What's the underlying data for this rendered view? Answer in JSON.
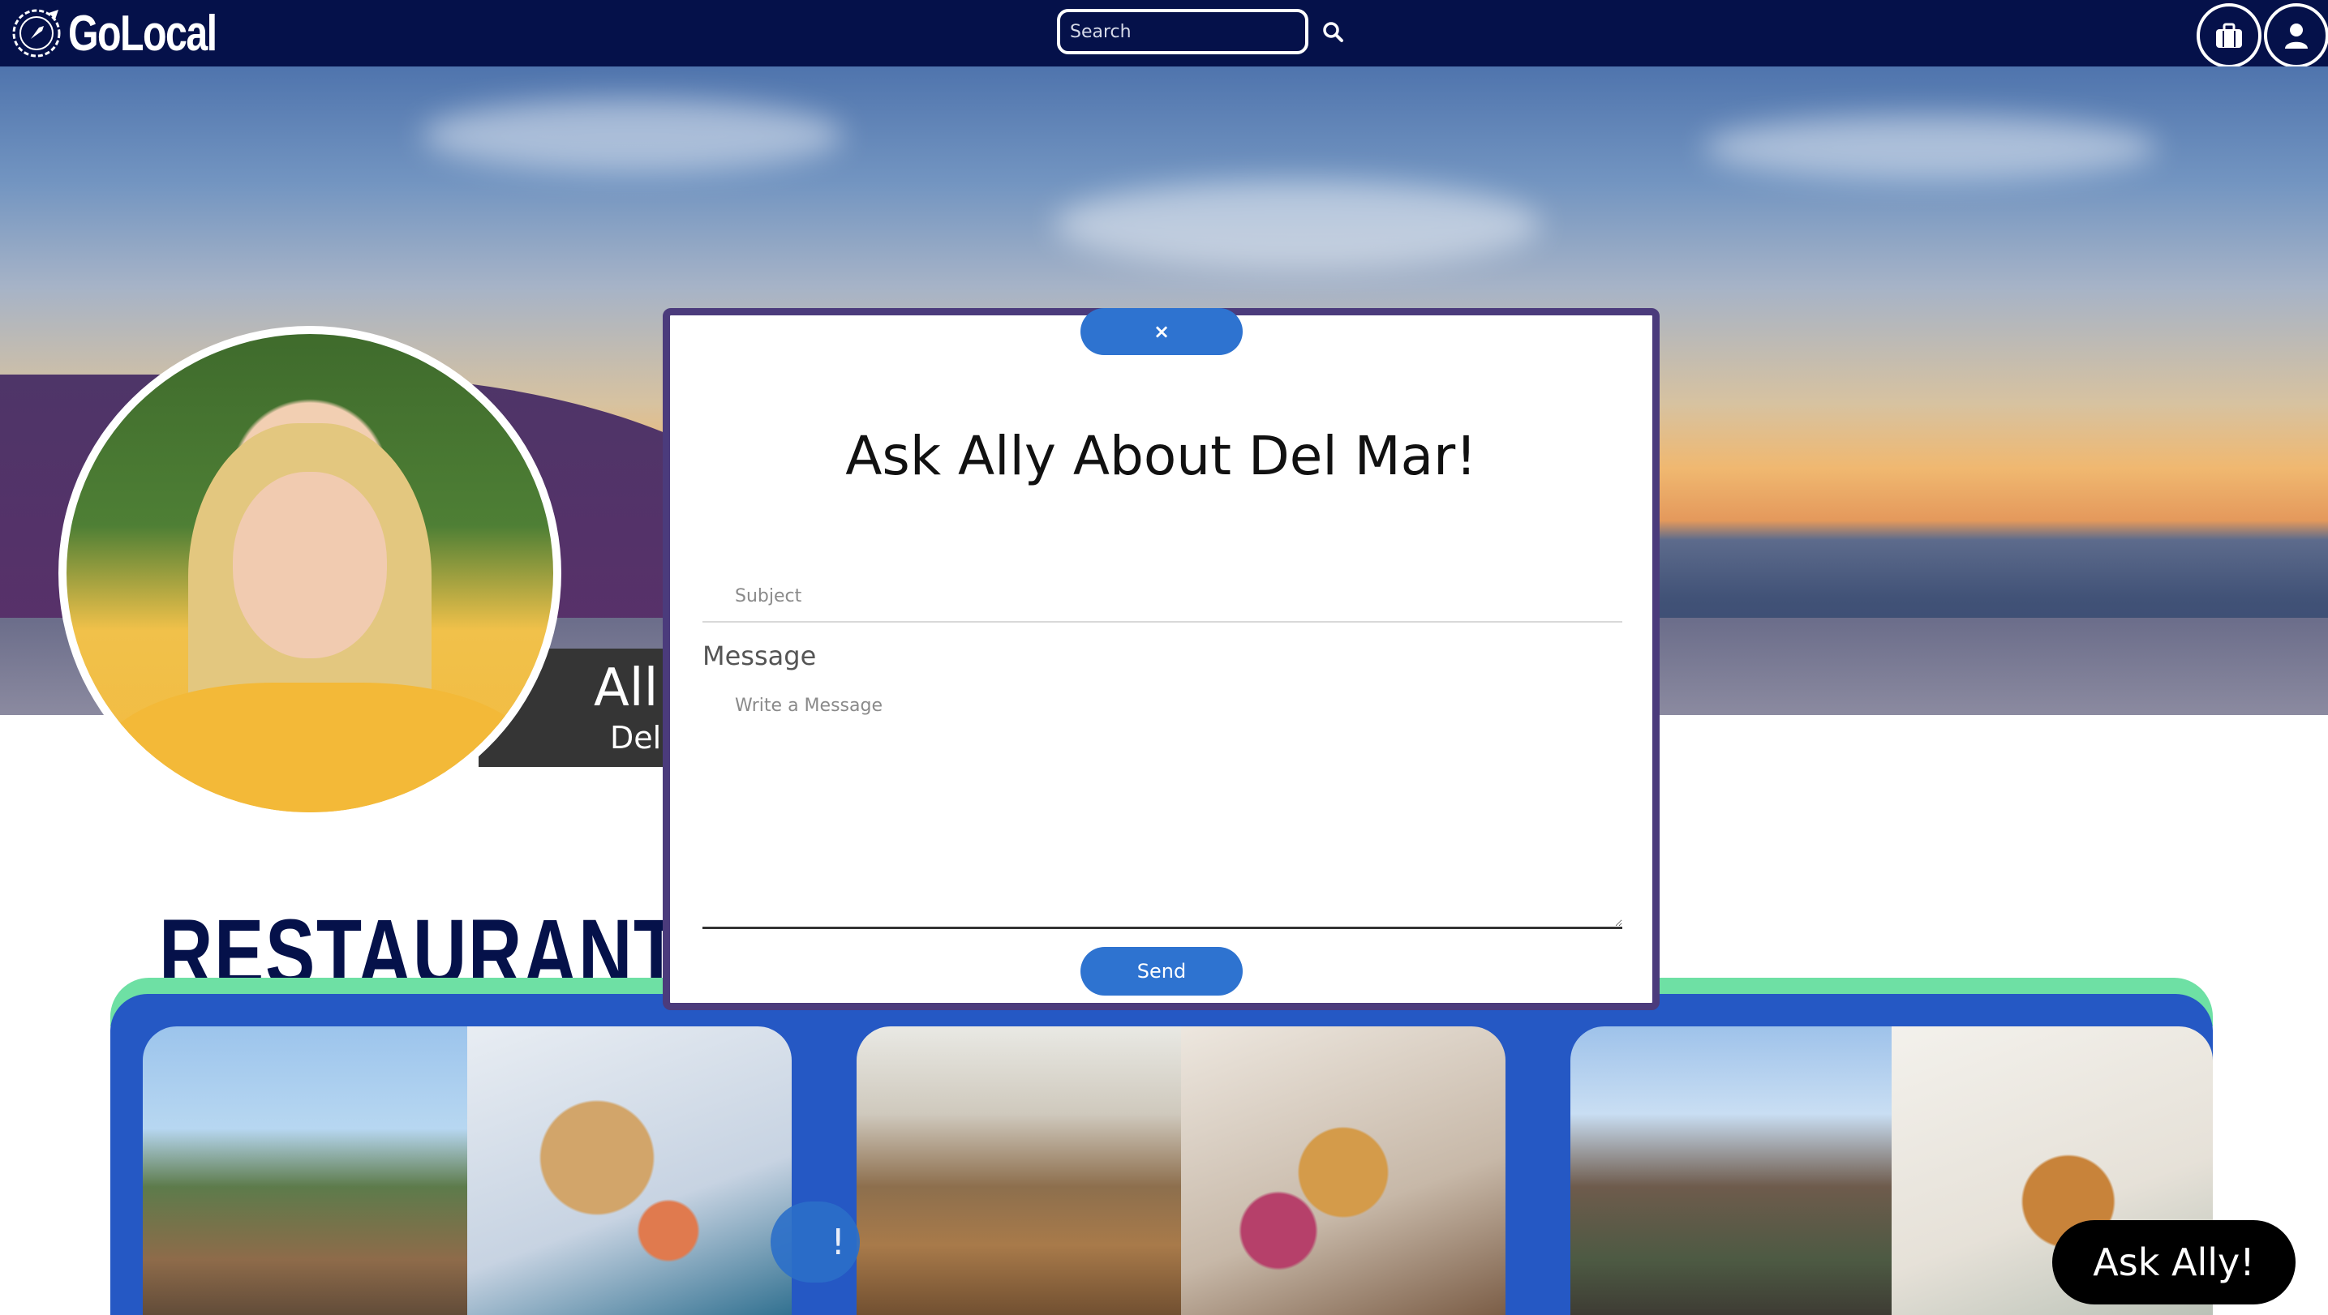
{
  "brand": {
    "name": "GoLocal"
  },
  "navbar": {
    "search_placeholder": "Search",
    "search_icon": "search-icon",
    "bag_icon": "briefcase-icon",
    "user_icon": "user-icon"
  },
  "guide": {
    "name": "All",
    "location": "Del"
  },
  "section": {
    "title": "RESTAURANTS"
  },
  "floating": {
    "ask_label": "Ask Ally!",
    "ghost_label": "!"
  },
  "modal": {
    "close_label": "×",
    "title": "Ask Ally About Del Mar!",
    "subject_placeholder": "Subject",
    "message_label": "Message",
    "message_placeholder": "Write a Message",
    "send_label": "Send"
  },
  "colors": {
    "navbar": "#05114a",
    "accent": "#2e73d0",
    "panel": "#2558c4",
    "strip": "#6ee0a4",
    "modal_border": "#4b3b7c"
  }
}
